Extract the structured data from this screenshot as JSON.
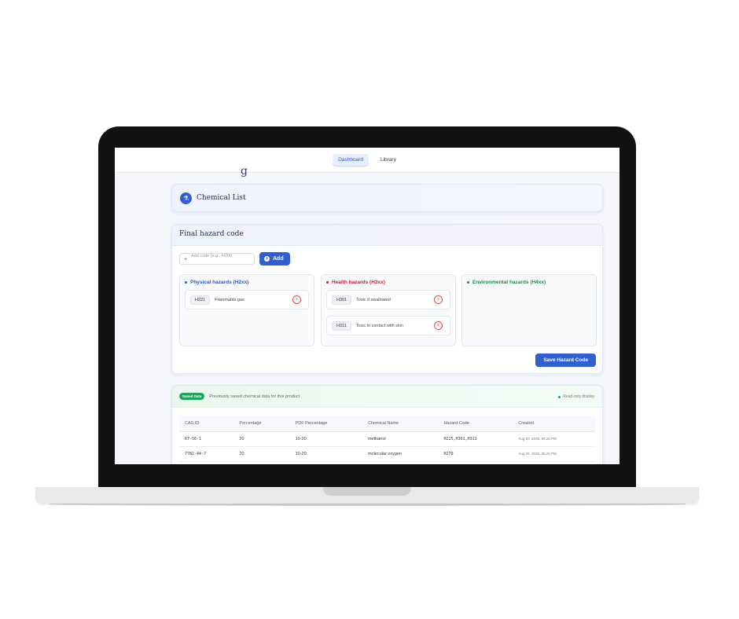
{
  "nav": {
    "tabs": [
      {
        "label": "Dashboard"
      },
      {
        "label": "Library"
      }
    ]
  },
  "header": {
    "ghost_title": "g"
  },
  "chemical_list": {
    "title": "Chemical List"
  },
  "hazard": {
    "title": "Final hazard code",
    "input_placeholder": "Add code (e.g., H200",
    "add_label": "Add",
    "columns": [
      {
        "title": "Physical hazards (H2xx)",
        "items": [
          {
            "code": "H221",
            "desc": "Flammable gas"
          }
        ]
      },
      {
        "title": "Health hazards (H3xx)",
        "items": [
          {
            "code": "H301",
            "desc": "Toxic if swallowed"
          },
          {
            "code": "H311",
            "desc": "Toxic in contact with skin"
          }
        ]
      },
      {
        "title": "Environmental hazards (H4xx)",
        "items": []
      }
    ],
    "save_label": "Save Hazard Code"
  },
  "saved": {
    "badge": "Saved Data",
    "description": "Previously saved chemical data for this product",
    "readonly": "Read-only display",
    "headers": [
      "CAS ID",
      "Percentage",
      "PDF Percentage",
      "Chemical Name",
      "Hazard Code",
      "Created"
    ],
    "rows": [
      [
        "67-56-1",
        "20",
        "10-20",
        "methanol",
        "H225,H301,H311",
        "Aug 20, 2025, 06:20 PM"
      ],
      [
        "7782-44-7",
        "20",
        "10-20",
        "molecular oxygen",
        "H270",
        "Aug 20, 2025, 06:20 PM"
      ]
    ]
  },
  "colors": {
    "accent": "#2f5fd0",
    "physical": "#2a55c8",
    "health": "#c62030",
    "environment": "#1a8a4a",
    "saved": "#22a35a"
  }
}
